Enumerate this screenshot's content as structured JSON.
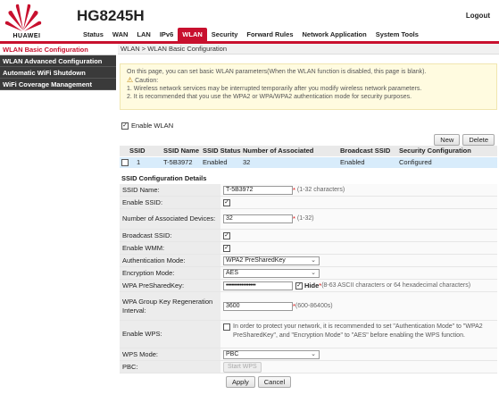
{
  "brand": {
    "logo_text": "HUAWEI",
    "model": "HG8245H",
    "logout": "Logout",
    "accent": "#c8102e"
  },
  "nav": [
    "Status",
    "WAN",
    "LAN",
    "IPv6",
    "WLAN",
    "Security",
    "Forward Rules",
    "Network Application",
    "System Tools"
  ],
  "sidebar": [
    "WLAN Basic Configuration",
    "WLAN Advanced Configuration",
    "Automatic WiFi Shutdown",
    "WiFi Coverage Management"
  ],
  "breadcrumb": "WLAN > WLAN Basic Configuration",
  "notice": {
    "intro": "On this page, you can set basic WLAN parameters(When the WLAN function is disabled, this page is blank).",
    "caution": "Caution:",
    "line1": "1. Wireless network services may be interrupted temporarily after you modify wireless network parameters.",
    "line2": "2. It is recommended that you use the WPA2 or WPA/WPA2 authentication mode for security purposes."
  },
  "enable_wlan": {
    "label": "Enable WLAN",
    "checked": true
  },
  "buttons": {
    "new": "New",
    "delete": "Delete"
  },
  "ssid_table": {
    "headers": [
      "SSID Index",
      "SSID Name",
      "SSID Status",
      "Number of Associated Devices",
      "Broadcast SSID",
      "Security Configuration"
    ],
    "rows": [
      [
        "1",
        "T-5B3972",
        "Enabled",
        "32",
        "Enabled",
        "Configured"
      ]
    ]
  },
  "details": {
    "title": "SSID Configuration Details",
    "ssid_name": {
      "label": "SSID Name:",
      "value": "T-5B3972",
      "hint": "(1-32 characters)"
    },
    "enable_ssid": {
      "label": "Enable SSID:",
      "checked": true
    },
    "num_devices": {
      "label": "Number of Associated Devices:",
      "value": "32",
      "hint": "(1-32)"
    },
    "broadcast_ssid": {
      "label": "Broadcast SSID:",
      "checked": true
    },
    "enable_wmm": {
      "label": "Enable WMM:",
      "checked": true
    },
    "auth_mode": {
      "label": "Authentication Mode:",
      "value": "WPA2 PreSharedKey"
    },
    "encryption_mode": {
      "label": "Encryption Mode:",
      "value": "AES"
    },
    "psk": {
      "label": "WPA PreSharedKey:",
      "value": "•••••••••••••••••",
      "hide_label": "Hide",
      "hint": "(8-63 ASCII characters or 64 hexadecimal characters)"
    },
    "group_key": {
      "label": "WPA Group Key Regeneration Interval:",
      "value": "3600",
      "hint": "(600-86400s)"
    },
    "enable_wps": {
      "label": "Enable WPS:",
      "checked": false,
      "text": "In order to protect your network, it is recommended to set \"Authentication Mode\" to \"WPA2 PreSharedKey\", and \"Encryption Mode\" to \"AES\" before enabling the WPS function."
    },
    "wps_mode": {
      "label": "WPS Mode:",
      "value": "PBC"
    },
    "pbc": {
      "label": "PBC:",
      "button": "Start WPS"
    }
  },
  "actions": {
    "apply": "Apply",
    "cancel": "Cancel"
  }
}
